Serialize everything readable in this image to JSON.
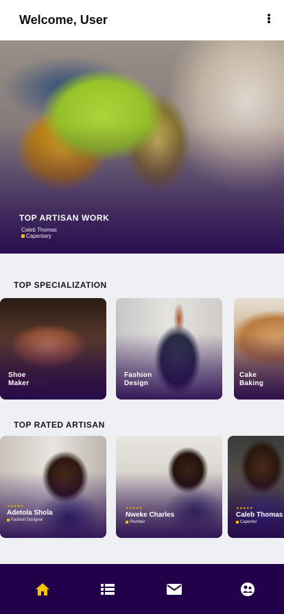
{
  "header": {
    "title": "Welcome, User",
    "menu_icon": "more-vertical-icon"
  },
  "hero": {
    "title": "TOP ARTISAN WORK",
    "artisan_name": "Caleb Thomas",
    "specialization": "Capentary"
  },
  "sections": {
    "specialization_title": "TOP SPECIALIZATION",
    "rated_title": "TOP RATED ARTISAN"
  },
  "specializations": [
    {
      "label": "Shoe\nMaker"
    },
    {
      "label": "Fashion\nDesign"
    },
    {
      "label": "Cake\nBaking"
    }
  ],
  "artisans": [
    {
      "stars": "★★★★★",
      "name": "Adetola Shola",
      "role": "Fashion Designer"
    },
    {
      "stars": "★★★★★",
      "name": "Nweke Charles",
      "role": "Plumber"
    },
    {
      "stars": "★★★★★",
      "name": "Caleb Thomas",
      "role": "Capenter"
    }
  ],
  "bottom_nav": [
    {
      "icon": "home-icon",
      "active": true
    },
    {
      "icon": "list-icon",
      "active": false
    },
    {
      "icon": "mail-icon",
      "active": false
    },
    {
      "icon": "profile-icon",
      "active": false
    }
  ],
  "colors": {
    "accent": "#f5c400",
    "nav_bg": "#22004a",
    "overlay": "#26084e"
  }
}
